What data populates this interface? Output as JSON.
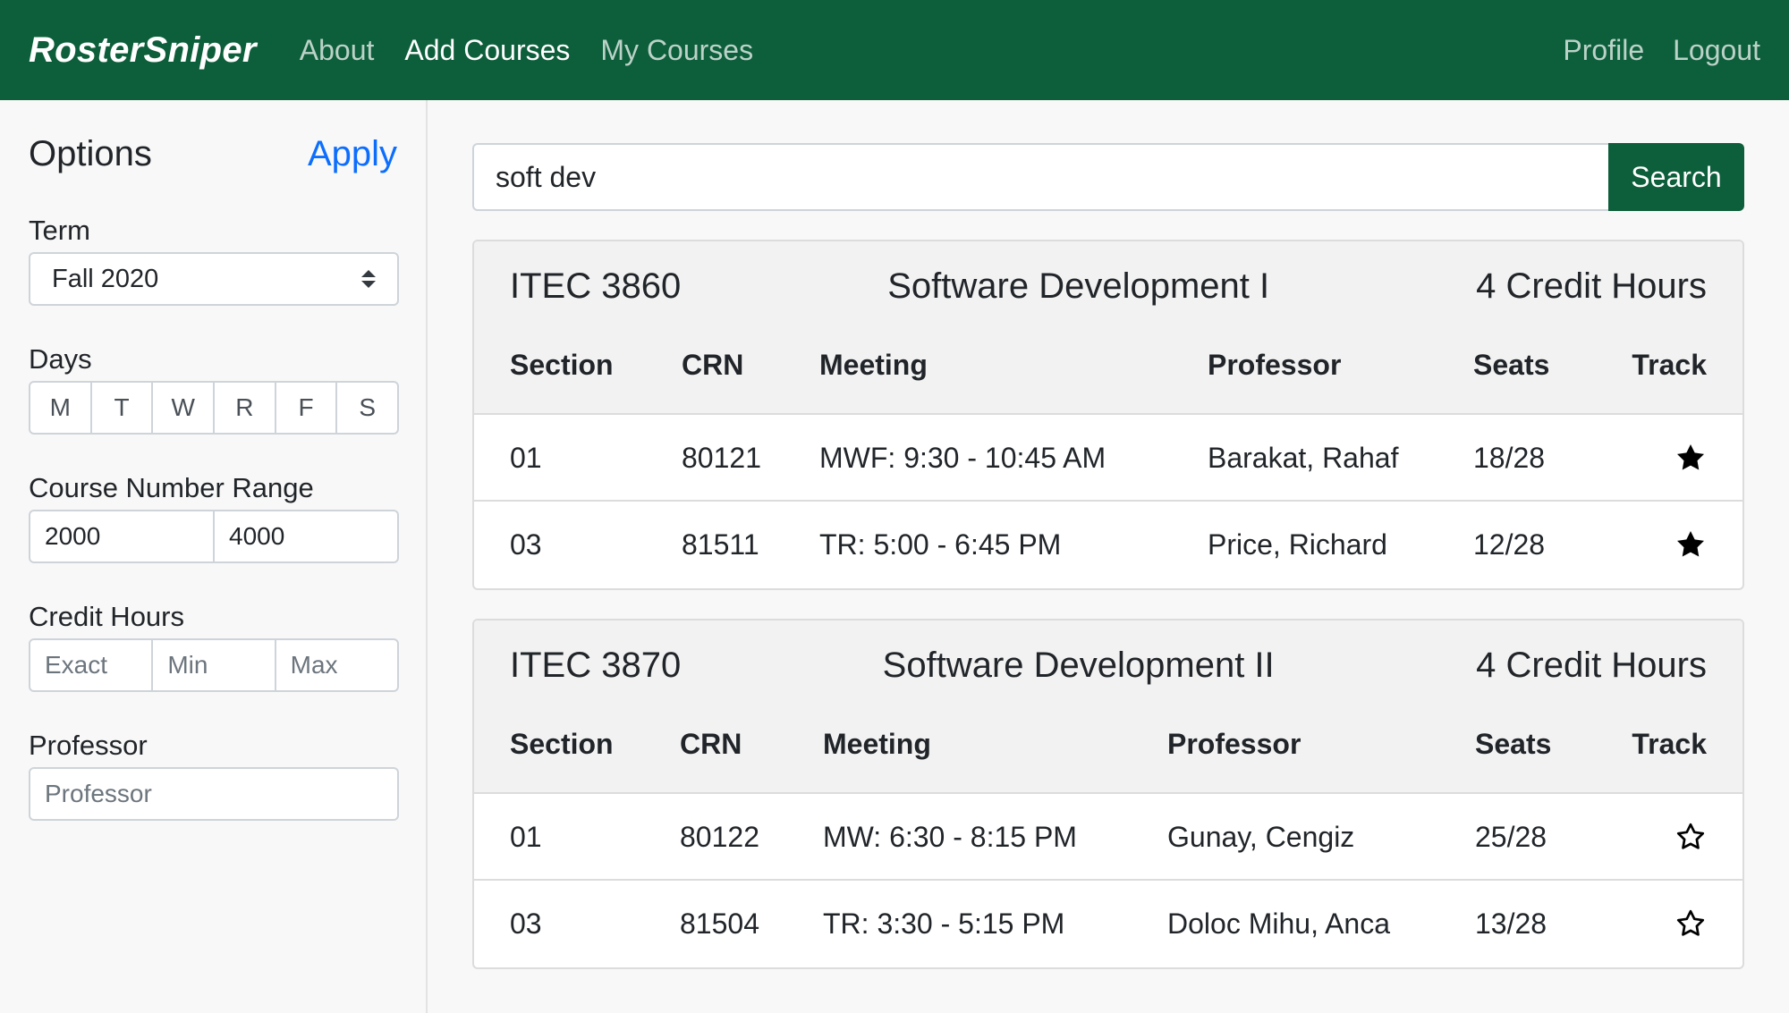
{
  "navbar": {
    "brand": "RosterSniper",
    "links": [
      "About",
      "Add Courses",
      "My Courses"
    ],
    "right_links": [
      "Profile",
      "Logout"
    ]
  },
  "sidebar": {
    "title": "Options",
    "apply": "Apply",
    "term_label": "Term",
    "term_value": "Fall 2020",
    "days_label": "Days",
    "days": [
      "M",
      "T",
      "W",
      "R",
      "F",
      "S"
    ],
    "range_label": "Course Number Range",
    "range_min": "2000",
    "range_max": "4000",
    "credit_label": "Credit Hours",
    "credit_exact": "Exact",
    "credit_min": "Min",
    "credit_max": "Max",
    "professor_label": "Professor",
    "professor_placeholder": "Professor"
  },
  "search": {
    "value": "soft dev",
    "button": "Search"
  },
  "columns": [
    "Section",
    "CRN",
    "Meeting",
    "Professor",
    "Seats",
    "Track"
  ],
  "courses": [
    {
      "code": "ITEC 3860",
      "title": "Software Development I",
      "credits": "4 Credit Hours",
      "sections": [
        {
          "section": "01",
          "crn": "80121",
          "meeting": "MWF: 9:30 - 10:45 AM",
          "professor": "Barakat, Rahaf",
          "seats": "18/28",
          "tracked": true
        },
        {
          "section": "03",
          "crn": "81511",
          "meeting": "TR: 5:00 - 6:45 PM",
          "professor": "Price, Richard",
          "seats": "12/28",
          "tracked": true
        }
      ]
    },
    {
      "code": "ITEC 3870",
      "title": "Software Development II",
      "credits": "4 Credit Hours",
      "sections": [
        {
          "section": "01",
          "crn": "80122",
          "meeting": "MW: 6:30 - 8:15 PM",
          "professor": "Gunay, Cengiz",
          "seats": "25/28",
          "tracked": false
        },
        {
          "section": "03",
          "crn": "81504",
          "meeting": "TR: 3:30 - 5:15 PM",
          "professor": "Doloc Mihu, Anca",
          "seats": "13/28",
          "tracked": false
        }
      ]
    }
  ],
  "colors": {
    "brand_green": "#0d5e3a",
    "link_blue": "#0d6efd"
  },
  "icons": {
    "tracked": "star-filled-icon",
    "untracked": "star-outline-icon"
  }
}
